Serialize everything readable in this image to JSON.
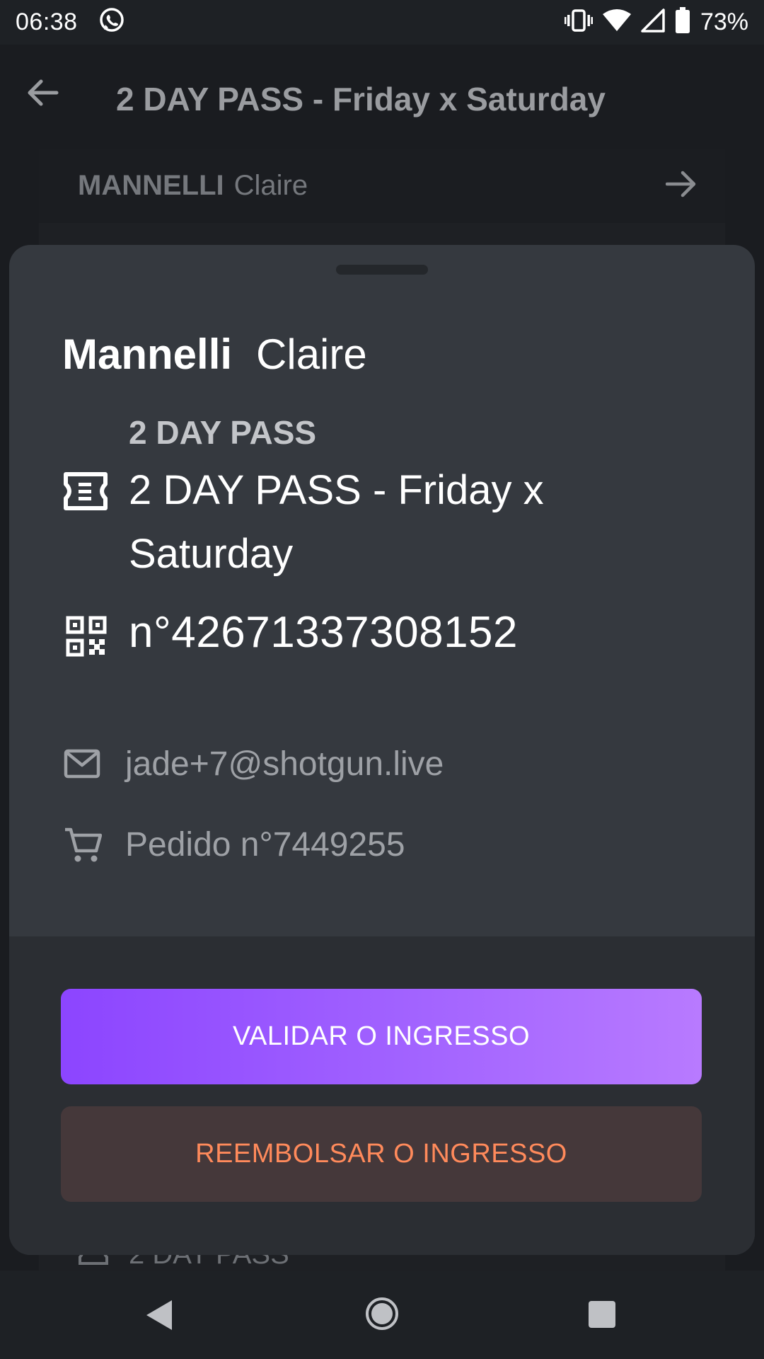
{
  "status_bar": {
    "time": "06:38",
    "battery": "73%",
    "icons": [
      "whatsapp-icon",
      "vibrate-icon",
      "wifi-icon",
      "signal-icon",
      "battery-icon"
    ]
  },
  "app_bar": {
    "title": "2 DAY PASS - Friday x Saturday",
    "back_icon": "arrow-left-icon"
  },
  "background_list": {
    "header_last_name": "MANNELLI",
    "header_first_name": "Claire",
    "peek_label": "2 DAY PASS"
  },
  "sheet": {
    "last_name": "Mannelli",
    "first_name": "Claire",
    "ticket_category": "2 DAY PASS",
    "ticket_name": "2 DAY PASS - Friday x Saturday",
    "ticket_number": "n°42671337308152",
    "email": "jade+7@shotgun.live",
    "order": "Pedido n°7449255",
    "validate_label": "VALIDAR O INGRESSO",
    "refund_label": "REEMBOLSAR O INGRESSO"
  },
  "colors": {
    "sheet_bg": "#35393f",
    "accent_gradient_start": "#8c45ff",
    "accent_gradient_end": "#b87aff",
    "refund_text": "#ff8a5b",
    "refund_bg": "#45383a"
  }
}
